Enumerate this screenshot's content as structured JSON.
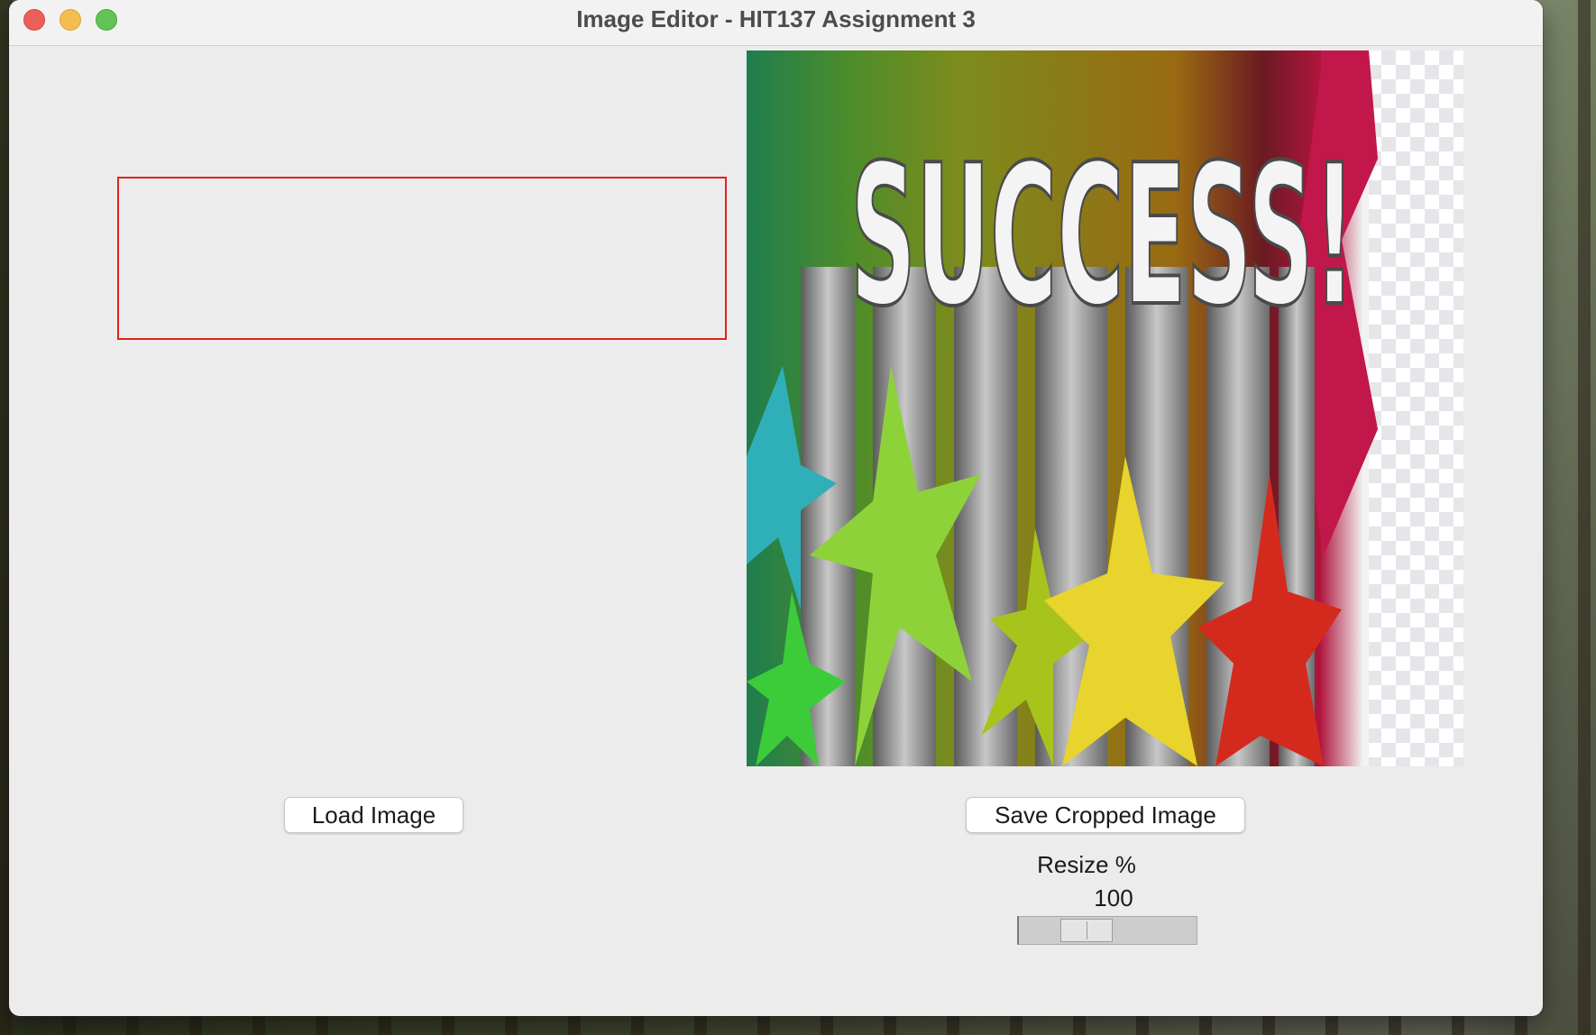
{
  "window": {
    "title": "Image Editor - HIT137 Assignment 3"
  },
  "canvas": {
    "image_text": "SUCCESS!",
    "crop_selection_color": "#e0231d"
  },
  "buttons": {
    "load_label": "Load Image",
    "save_label": "Save Cropped Image"
  },
  "resize": {
    "label": "Resize %",
    "value": "100",
    "slider_fraction": 0.33
  },
  "colors": {
    "window_bg": "#ececec",
    "close": "#ec5f58",
    "minimize": "#f4bd4f",
    "maximize": "#61c454"
  }
}
